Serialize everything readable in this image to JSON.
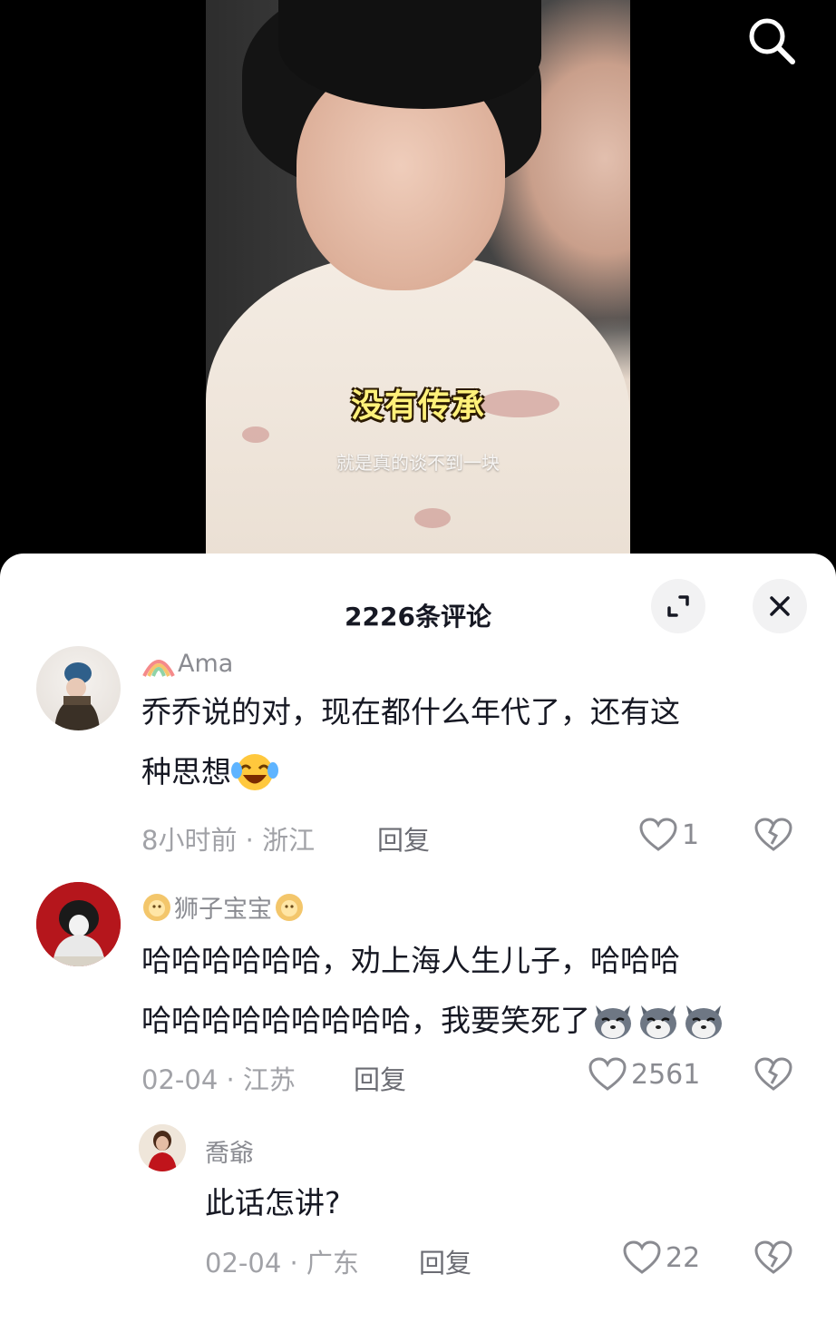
{
  "video": {
    "caption_main": "没有传承",
    "caption_sub": "就是真的谈不到一块",
    "search_icon": "search-icon"
  },
  "sheet": {
    "title": "2226条评论",
    "expand_icon": "expand-icon",
    "close_icon": "close-icon"
  },
  "comments": [
    {
      "username": "Ama",
      "username_prefix_icon": "rainbow-icon",
      "text_line1": "乔乔说的对，现在都什么年代了，还有这",
      "text_line2": "种思想",
      "emoji": "laugh-cry-emoji",
      "time": "8小时前 · 浙江",
      "reply_label": "回复",
      "likes": "1"
    },
    {
      "username": "狮子宝宝",
      "username_icons": [
        "lion-icon",
        "lion-icon"
      ],
      "text_line1": "哈哈哈哈哈哈，劝上海人生儿子，哈哈哈",
      "text_line2": "哈哈哈哈哈哈哈哈哈，我要笑死了",
      "emojis": [
        "husky-emoji",
        "husky-emoji",
        "husky-emoji"
      ],
      "time": "02-04 · 江苏",
      "reply_label": "回复",
      "likes": "2561"
    },
    {
      "username": "喬爺",
      "text_line1": "此话怎讲?",
      "time": "02-04 · 广东",
      "reply_label": "回复",
      "likes": "22"
    }
  ],
  "colors": {
    "text_primary": "#161823",
    "text_secondary": "#8a8b91",
    "caption_yellow": "#fff17a",
    "sheet_bg": "#ffffff",
    "button_bg": "#f2f2f3"
  }
}
